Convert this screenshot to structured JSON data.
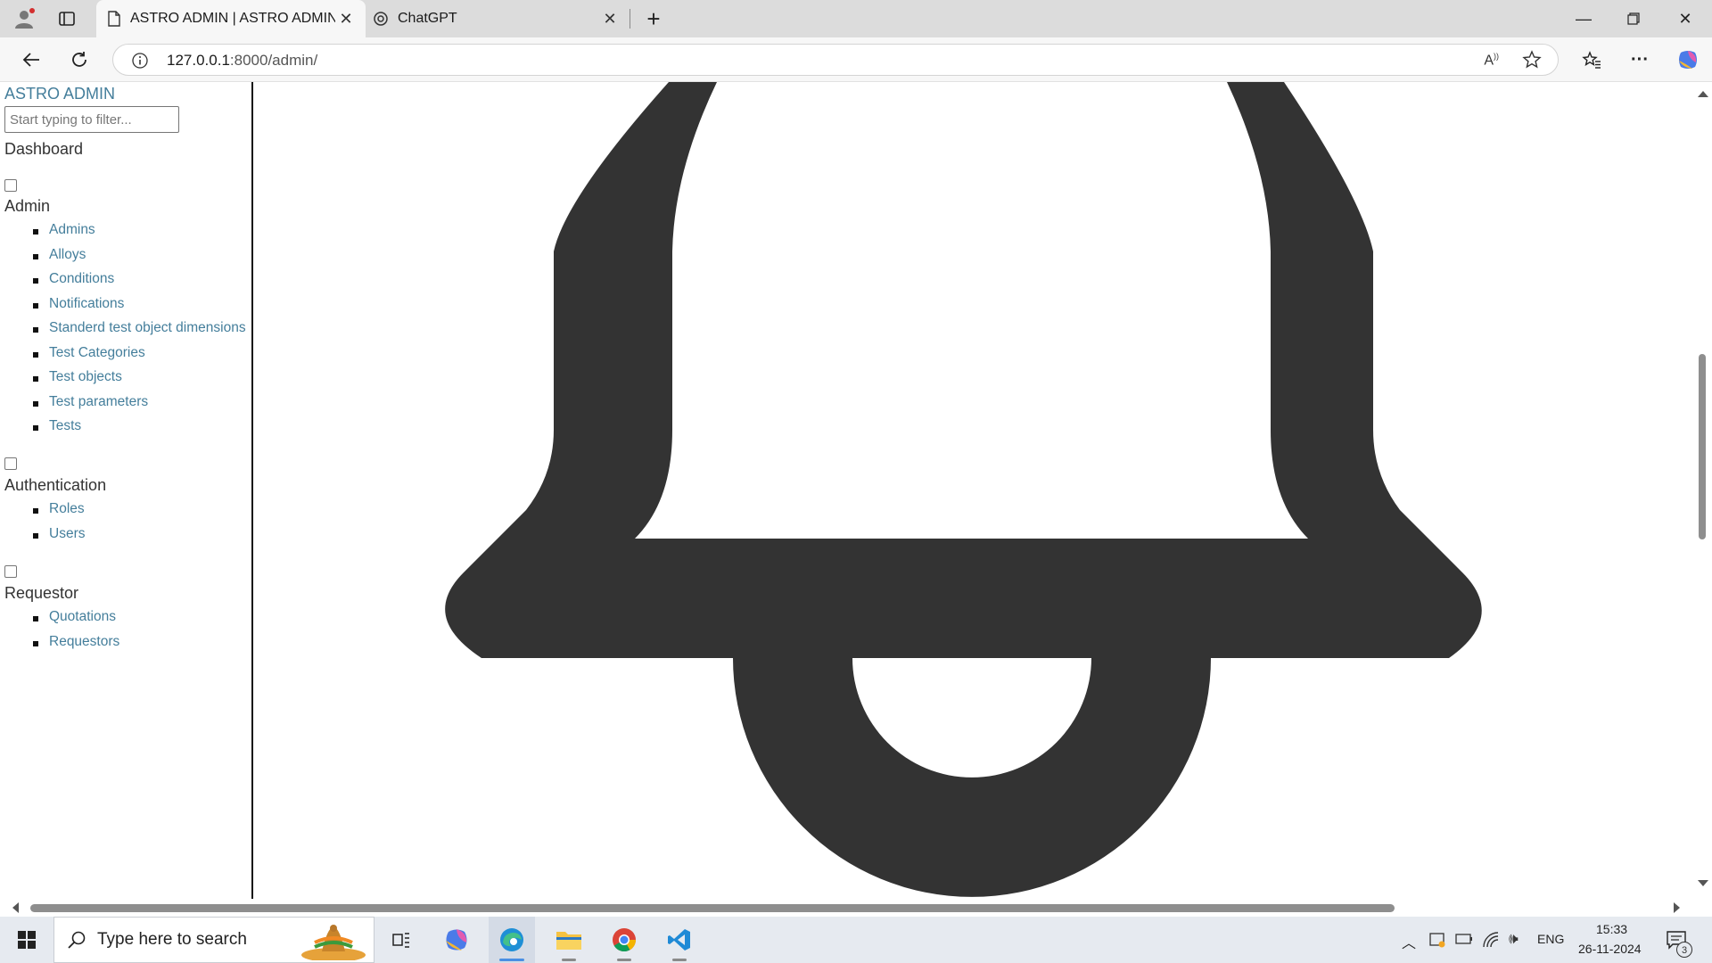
{
  "browser": {
    "tabs": [
      {
        "title": "ASTRO ADMIN | ASTRO ADMIN",
        "active": true
      },
      {
        "title": "ChatGPT",
        "active": false
      }
    ],
    "new_tab_label": "+",
    "address": {
      "host": "127.0.0.1",
      "rest": ":8000/admin/"
    }
  },
  "sidebar": {
    "brand": "ASTRO ADMIN",
    "filter_placeholder": "Start typing to filter...",
    "dashboard": "Dashboard",
    "groups": [
      {
        "title": "Admin",
        "items": [
          "Admins",
          "Alloys",
          "Conditions",
          "Notifications",
          "Standerd test object dimensions",
          "Test Categories",
          "Test objects",
          "Test parameters",
          "Tests"
        ]
      },
      {
        "title": "Authentication",
        "items": [
          "Roles",
          "Users"
        ]
      },
      {
        "title": "Requestor",
        "items": [
          "Quotations",
          "Requestors"
        ]
      }
    ]
  },
  "content": {
    "icon": "bell-icon",
    "icon_color": "#333333"
  },
  "taskbar": {
    "search_placeholder": "Type here to search",
    "language": "ENG",
    "time": "15:33",
    "date": "26-11-2024",
    "notification_count": "3"
  },
  "colors": {
    "link": "#447e9b",
    "tabstrip": "#dcdcdc",
    "toolbar": "#f7f7f7",
    "taskbar": "#e6eaf0"
  }
}
